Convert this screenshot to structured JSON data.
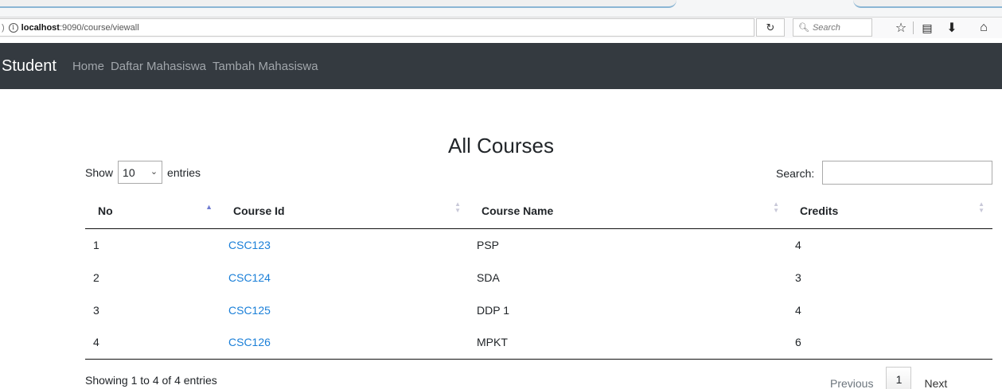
{
  "browser": {
    "url_host": "localhost",
    "url_rest": ":9090/course/viewall",
    "search_placeholder": "Search",
    "icons": [
      "info-icon",
      "reload-icon",
      "search-icon",
      "bookmark-star-icon",
      "reading-list-icon",
      "download-icon",
      "home-icon"
    ]
  },
  "navbar": {
    "brand": "Student",
    "links": [
      "Home",
      "Daftar Mahasiswa",
      "Tambah Mahasiswa"
    ]
  },
  "page": {
    "title": "All Courses",
    "show_label": "Show",
    "entries_label": "entries",
    "page_length": "10",
    "search_label": "Search:"
  },
  "table": {
    "headers": [
      "No",
      "Course Id",
      "Course Name",
      "Credits"
    ],
    "rows": [
      [
        "1",
        "CSC123",
        "PSP",
        "4"
      ],
      [
        "2",
        "CSC124",
        "SDA",
        "3"
      ],
      [
        "3",
        "CSC125",
        "DDP 1",
        "4"
      ],
      [
        "4",
        "CSC126",
        "MPKT",
        "6"
      ]
    ]
  },
  "footer": {
    "info": "Showing 1 to 4 of 4 entries",
    "previous": "Previous",
    "current_page": "1",
    "next": "Next"
  },
  "colors": {
    "navbar_bg": "#343a40",
    "link": "#1a7fd8",
    "nav_link": "#a1a6ab"
  }
}
